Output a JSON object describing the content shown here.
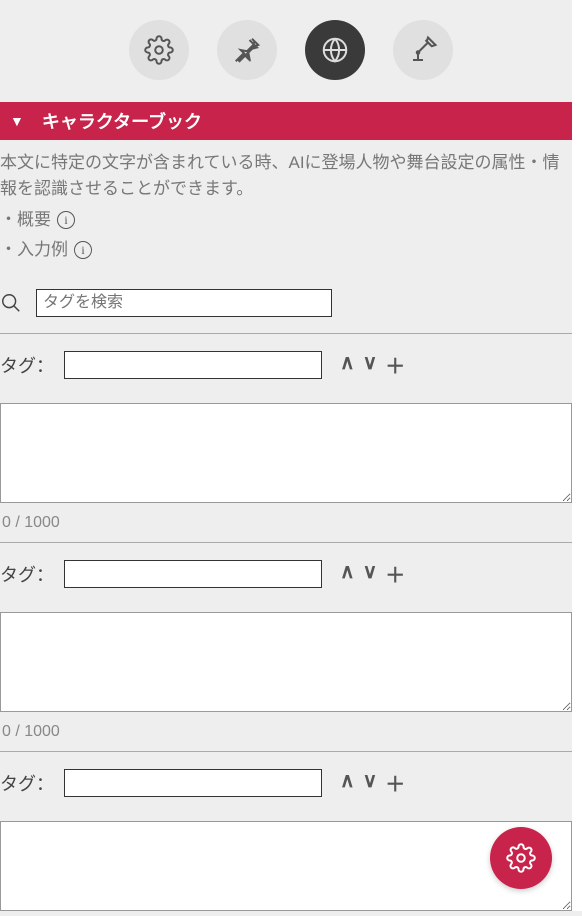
{
  "tabs": {
    "icons": [
      "gear-icon",
      "pin-icon",
      "globe-icon",
      "lamp-icon"
    ],
    "active_index": 2
  },
  "section": {
    "title": "キャラクターブック",
    "description": "本文に特定の文字が含まれている時、AIに登場人物や舞台設定の属性・情報を認識させることができます。",
    "link_overview": "・概要",
    "link_example": "・入力例"
  },
  "search": {
    "placeholder": "タグを検索"
  },
  "entries": [
    {
      "tag_label": "タグ：",
      "tag_value": "",
      "body_value": "",
      "counter": "0 / 1000"
    },
    {
      "tag_label": "タグ：",
      "tag_value": "",
      "body_value": "",
      "counter": "0 / 1000"
    },
    {
      "tag_label": "タグ：",
      "tag_value": "",
      "body_value": "",
      "counter": ""
    }
  ],
  "controls": {
    "up": "∧",
    "down": "∨",
    "add": "＋"
  },
  "colors": {
    "accent": "#c8234b",
    "tab_bg": "#e0e0e0",
    "tab_active_bg": "#3a3a3a"
  }
}
